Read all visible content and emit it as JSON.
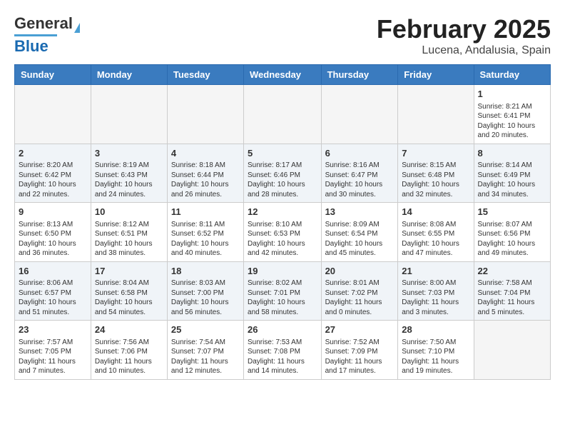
{
  "header": {
    "logo_line1": "General",
    "logo_line2": "Blue",
    "title": "February 2025",
    "subtitle": "Lucena, Andalusia, Spain"
  },
  "weekdays": [
    "Sunday",
    "Monday",
    "Tuesday",
    "Wednesday",
    "Thursday",
    "Friday",
    "Saturday"
  ],
  "weeks": [
    [
      {
        "day": "",
        "info": ""
      },
      {
        "day": "",
        "info": ""
      },
      {
        "day": "",
        "info": ""
      },
      {
        "day": "",
        "info": ""
      },
      {
        "day": "",
        "info": ""
      },
      {
        "day": "",
        "info": ""
      },
      {
        "day": "1",
        "info": "Sunrise: 8:21 AM\nSunset: 6:41 PM\nDaylight: 10 hours and 20 minutes."
      }
    ],
    [
      {
        "day": "2",
        "info": "Sunrise: 8:20 AM\nSunset: 6:42 PM\nDaylight: 10 hours and 22 minutes."
      },
      {
        "day": "3",
        "info": "Sunrise: 8:19 AM\nSunset: 6:43 PM\nDaylight: 10 hours and 24 minutes."
      },
      {
        "day": "4",
        "info": "Sunrise: 8:18 AM\nSunset: 6:44 PM\nDaylight: 10 hours and 26 minutes."
      },
      {
        "day": "5",
        "info": "Sunrise: 8:17 AM\nSunset: 6:46 PM\nDaylight: 10 hours and 28 minutes."
      },
      {
        "day": "6",
        "info": "Sunrise: 8:16 AM\nSunset: 6:47 PM\nDaylight: 10 hours and 30 minutes."
      },
      {
        "day": "7",
        "info": "Sunrise: 8:15 AM\nSunset: 6:48 PM\nDaylight: 10 hours and 32 minutes."
      },
      {
        "day": "8",
        "info": "Sunrise: 8:14 AM\nSunset: 6:49 PM\nDaylight: 10 hours and 34 minutes."
      }
    ],
    [
      {
        "day": "9",
        "info": "Sunrise: 8:13 AM\nSunset: 6:50 PM\nDaylight: 10 hours and 36 minutes."
      },
      {
        "day": "10",
        "info": "Sunrise: 8:12 AM\nSunset: 6:51 PM\nDaylight: 10 hours and 38 minutes."
      },
      {
        "day": "11",
        "info": "Sunrise: 8:11 AM\nSunset: 6:52 PM\nDaylight: 10 hours and 40 minutes."
      },
      {
        "day": "12",
        "info": "Sunrise: 8:10 AM\nSunset: 6:53 PM\nDaylight: 10 hours and 42 minutes."
      },
      {
        "day": "13",
        "info": "Sunrise: 8:09 AM\nSunset: 6:54 PM\nDaylight: 10 hours and 45 minutes."
      },
      {
        "day": "14",
        "info": "Sunrise: 8:08 AM\nSunset: 6:55 PM\nDaylight: 10 hours and 47 minutes."
      },
      {
        "day": "15",
        "info": "Sunrise: 8:07 AM\nSunset: 6:56 PM\nDaylight: 10 hours and 49 minutes."
      }
    ],
    [
      {
        "day": "16",
        "info": "Sunrise: 8:06 AM\nSunset: 6:57 PM\nDaylight: 10 hours and 51 minutes."
      },
      {
        "day": "17",
        "info": "Sunrise: 8:04 AM\nSunset: 6:58 PM\nDaylight: 10 hours and 54 minutes."
      },
      {
        "day": "18",
        "info": "Sunrise: 8:03 AM\nSunset: 7:00 PM\nDaylight: 10 hours and 56 minutes."
      },
      {
        "day": "19",
        "info": "Sunrise: 8:02 AM\nSunset: 7:01 PM\nDaylight: 10 hours and 58 minutes."
      },
      {
        "day": "20",
        "info": "Sunrise: 8:01 AM\nSunset: 7:02 PM\nDaylight: 11 hours and 0 minutes."
      },
      {
        "day": "21",
        "info": "Sunrise: 8:00 AM\nSunset: 7:03 PM\nDaylight: 11 hours and 3 minutes."
      },
      {
        "day": "22",
        "info": "Sunrise: 7:58 AM\nSunset: 7:04 PM\nDaylight: 11 hours and 5 minutes."
      }
    ],
    [
      {
        "day": "23",
        "info": "Sunrise: 7:57 AM\nSunset: 7:05 PM\nDaylight: 11 hours and 7 minutes."
      },
      {
        "day": "24",
        "info": "Sunrise: 7:56 AM\nSunset: 7:06 PM\nDaylight: 11 hours and 10 minutes."
      },
      {
        "day": "25",
        "info": "Sunrise: 7:54 AM\nSunset: 7:07 PM\nDaylight: 11 hours and 12 minutes."
      },
      {
        "day": "26",
        "info": "Sunrise: 7:53 AM\nSunset: 7:08 PM\nDaylight: 11 hours and 14 minutes."
      },
      {
        "day": "27",
        "info": "Sunrise: 7:52 AM\nSunset: 7:09 PM\nDaylight: 11 hours and 17 minutes."
      },
      {
        "day": "28",
        "info": "Sunrise: 7:50 AM\nSunset: 7:10 PM\nDaylight: 11 hours and 19 minutes."
      },
      {
        "day": "",
        "info": ""
      }
    ]
  ]
}
